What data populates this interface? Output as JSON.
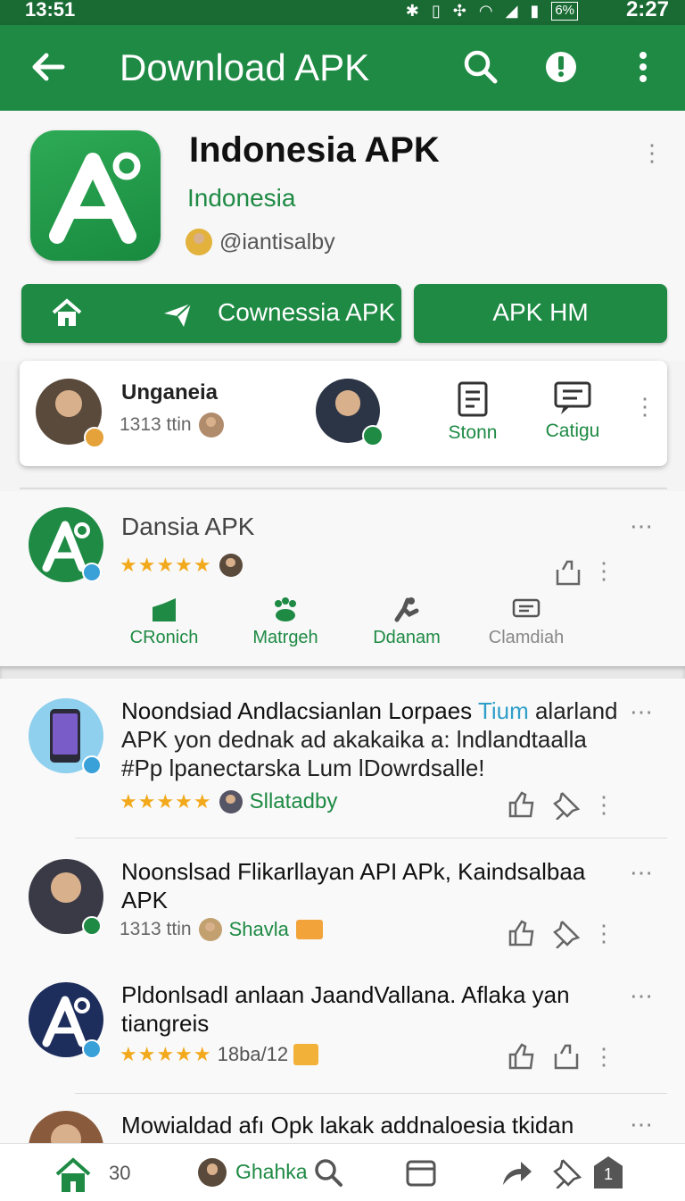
{
  "status": {
    "time": "13:51",
    "right_time": "2:27",
    "battery": "6%"
  },
  "appbar": {
    "title": "Download APK"
  },
  "app": {
    "title": "Indonesia APK",
    "subtitle": "Indonesia",
    "author": "@iantisalby"
  },
  "buttons": {
    "primary": "Cownessia APK",
    "secondary": "APK HM"
  },
  "user_card": {
    "name": "Unganeia",
    "meta": "1313 ttin",
    "action1": "Stonn",
    "action2": "Catigu"
  },
  "app_card": {
    "title": "Dansia APK",
    "rating_stars": "★★★★★",
    "actions": [
      "CRonich",
      "Matrgeh",
      "Ddanam",
      "Clamdiah"
    ]
  },
  "feed": [
    {
      "title_a": "Noondsiad Andlacsianlan Lorpaes ",
      "title_b": "Tium",
      "title_c": " alarland APK yon dednak ad akakaika a: lndlandtaalla #Pp lpanectarska Lum lDowrdsalle!",
      "rating_stars": "★★★★★",
      "meta": "Sllatadby"
    },
    {
      "title_a": "Noonslsad Flikarllayan API APk, Kaindsalbaa APK",
      "meta": "1313 ttin",
      "tag": "Shavla"
    },
    {
      "title_a": "Pldonlsadl anlaan JaandVallana. Aflaka yan tiangreis",
      "rating_stars": "★★★★★",
      "meta": "18ba/12"
    },
    {
      "title_a": "Mowialdad afı Opk lakak addnaloesia tkidan"
    }
  ],
  "bottom_nav": {
    "count": "30",
    "label": "Ghahka",
    "badge": "1"
  },
  "colors": {
    "primary": "#1e8a44",
    "status_bar": "#1a6a34",
    "star": "#f2a91c"
  }
}
